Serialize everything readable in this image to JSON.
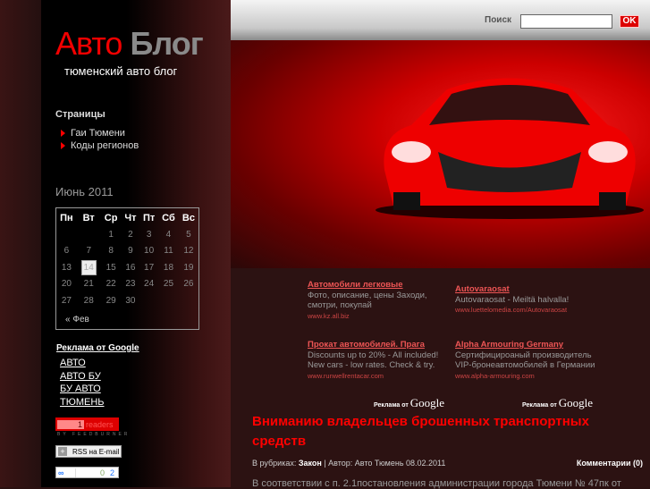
{
  "header": {
    "logo_part1": "Авто",
    "logo_part2": "Блог",
    "tagline": "тюменский авто блог",
    "search_label": "Поиск",
    "search_value": "",
    "search_button": "OK"
  },
  "sidebar": {
    "pages_heading": "Страницы",
    "pages": [
      "Гаи Тюмени",
      "Коды регионов"
    ],
    "calendar": {
      "caption": "Июнь 2011",
      "weekdays": [
        "Пн",
        "Вт",
        "Ср",
        "Чт",
        "Пт",
        "Сб",
        "Вс"
      ],
      "weeks": [
        [
          "",
          "",
          "1",
          "2",
          "3",
          "4",
          "5"
        ],
        [
          "6",
          "7",
          "8",
          "9",
          "10",
          "11",
          "12"
        ],
        [
          "13",
          "14",
          "15",
          "16",
          "17",
          "18",
          "19"
        ],
        [
          "20",
          "21",
          "22",
          "23",
          "24",
          "25",
          "26"
        ],
        [
          "27",
          "28",
          "29",
          "30",
          "",
          "",
          ""
        ]
      ],
      "today": "14",
      "prev": "« Фев"
    },
    "google_heading": "Реклама от Google",
    "google_links": [
      "АВТО",
      "АВТО БУ",
      "БУ АВТО",
      "ТЮМЕНЬ"
    ],
    "feedburner": {
      "count": "1",
      "label": "readers",
      "by": "BY FEEDBURNER"
    },
    "rss_button": "RSS на E-mail",
    "counter": {
      "a": "0",
      "b": "2"
    }
  },
  "ads": [
    {
      "title": "Автомобили легковые",
      "desc": "Фото, описание, цены Заходи, смотри, покупай",
      "url": "www.kz.all.biz"
    },
    {
      "title": "Autovaraosat",
      "desc": "Autovaraosat - Meiltä halvalla!",
      "url": "www.luettelomedia.com/Autovaraosat"
    },
    {
      "title": "Прокат автомобилей. Прага",
      "desc": "Discounts up to 20% - All included! New cars - low rates. Check & try.",
      "url": "www.runwellrentacar.com"
    },
    {
      "title": "Alpha Armouring Germany",
      "desc": "Сертифицироаный производитель VIP-бронеавтомобилей в Германии",
      "url": "www.alpha-armouring.com"
    }
  ],
  "ads_by": "Реклама от",
  "google": "Google",
  "post": {
    "title": "Вниманию владельцев брошенных транспортных средств",
    "rubric_label": "В рубриках:",
    "rubric": "Закон",
    "author": "| Автор: Авто Тюмень 08.02.2011",
    "comments": "Комментарии (0)",
    "body": "В соответствии с п. 2.1постановления администрации города Тюмени № 47пк от"
  }
}
